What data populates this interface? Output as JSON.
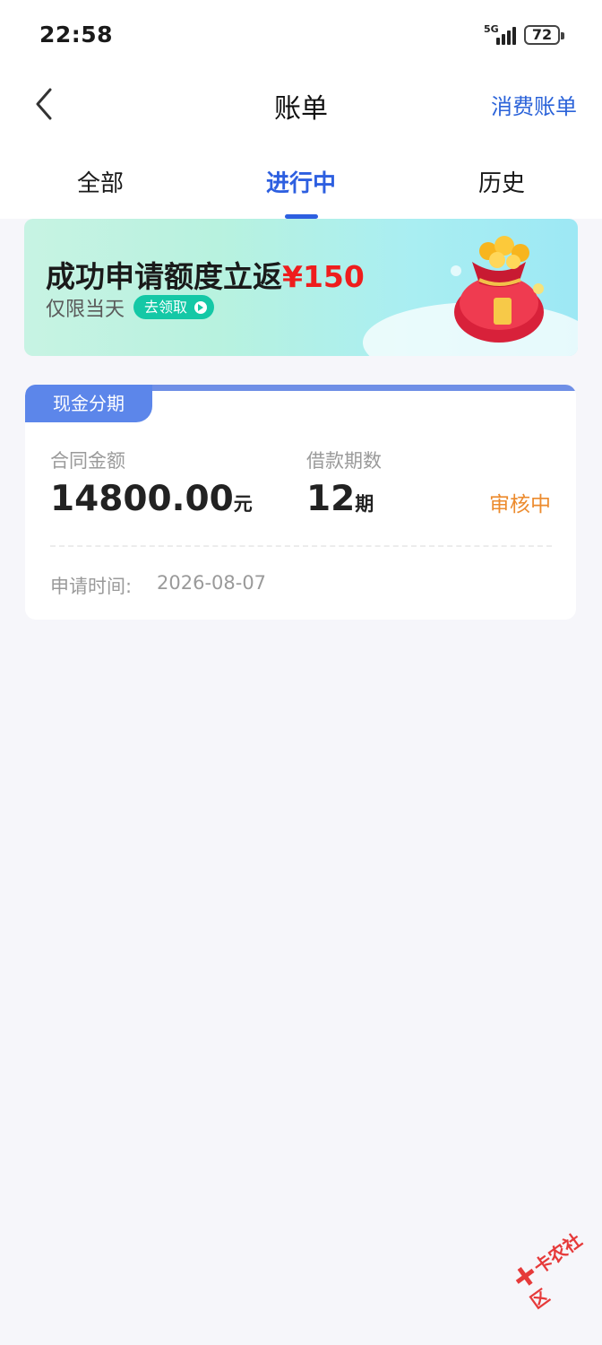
{
  "status_bar": {
    "time": "22:58",
    "network": "5G",
    "battery": "72"
  },
  "nav": {
    "title": "账单",
    "action": "消费账单"
  },
  "tabs": [
    {
      "label": "全部"
    },
    {
      "label": "进行中",
      "active": true
    },
    {
      "label": "历史"
    }
  ],
  "banner": {
    "title": "成功申请额度立返",
    "amount": "¥150",
    "subtitle": "仅限当天",
    "button": "去领取"
  },
  "card": {
    "tag": "现金分期",
    "contract_label": "合同金额",
    "contract_amount": "14800.00",
    "contract_unit": "元",
    "term_label": "借款期数",
    "term_value": "12",
    "term_unit": "期",
    "status": "审核中",
    "apply_label": "申请时间:",
    "apply_date": "2026-08-07"
  },
  "watermark": {
    "text": "卡农社区"
  },
  "colors": {
    "accent": "#2d5fe0",
    "status_pending": "#ec8b2e",
    "tag_bg": "#5c86ea",
    "banner_red": "#ee1d1d",
    "page_bg": "#f6f6fa"
  },
  "icons": [
    "back-arrow-icon",
    "signal-icon",
    "battery-icon",
    "lucky-bag-icon",
    "arrow-right-icon"
  ]
}
